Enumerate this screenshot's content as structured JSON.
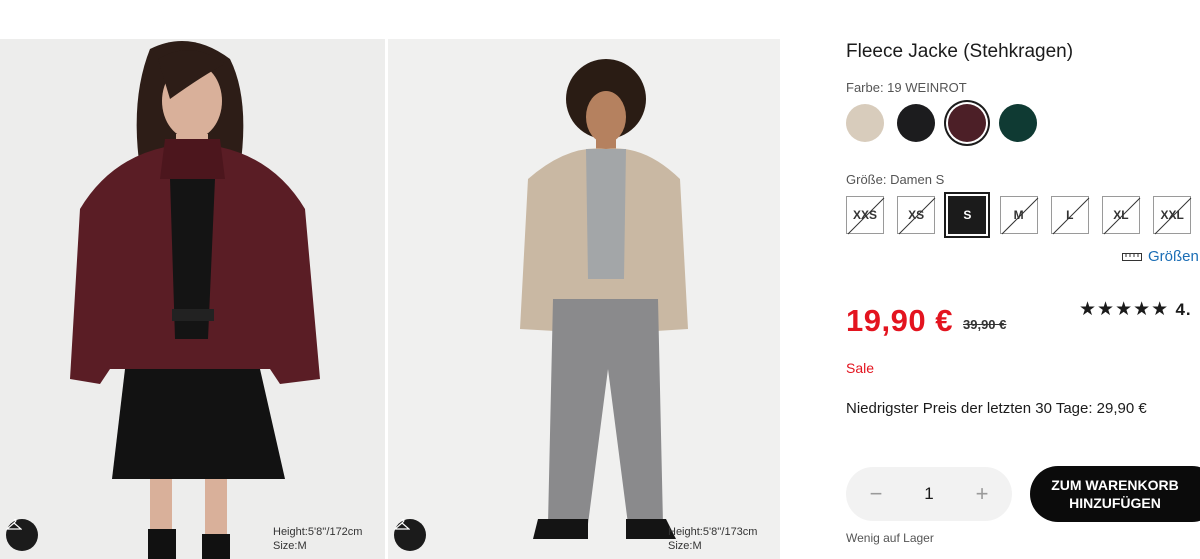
{
  "product": {
    "title": "Fleece Jacke (Stehkragen)",
    "color_label": "Farbe: 19 WEINROT",
    "colors": [
      {
        "name": "beige",
        "hex": "#d8ccbc"
      },
      {
        "name": "schwarz",
        "hex": "#1c1c1e"
      },
      {
        "name": "weinrot",
        "hex": "#4c1f27",
        "selected": true
      },
      {
        "name": "grün",
        "hex": "#0f3a33"
      }
    ],
    "size_label": "Größe: Damen S",
    "sizes": [
      "XXS",
      "XS",
      "S",
      "M",
      "L",
      "XL",
      "XXL"
    ],
    "selected_size": "S",
    "size_guide": "Größen",
    "price": "19,90 €",
    "old_price": "39,90 €",
    "stars": "★★★★★",
    "rating_visible": "4.",
    "sale_label": "Sale",
    "lowest_price": "Niedrigster Preis der letzten 30 Tage: 29,90 €",
    "quantity": "1",
    "qty_minus": "−",
    "qty_plus": "+",
    "cart_line1": "ZUM WARENKORB",
    "cart_line2": "HINZUFÜGEN",
    "stock": "Wenig auf Lager"
  },
  "gallery": [
    {
      "height": "Height:5'8''/172cm",
      "size": "Size:M"
    },
    {
      "height": "Height:5'8''/173cm",
      "size": "Size:M"
    }
  ],
  "colors": {
    "accent_red": "#e3141f",
    "link_blue": "#1a6db5",
    "button_dark": "#0b0b0b"
  }
}
